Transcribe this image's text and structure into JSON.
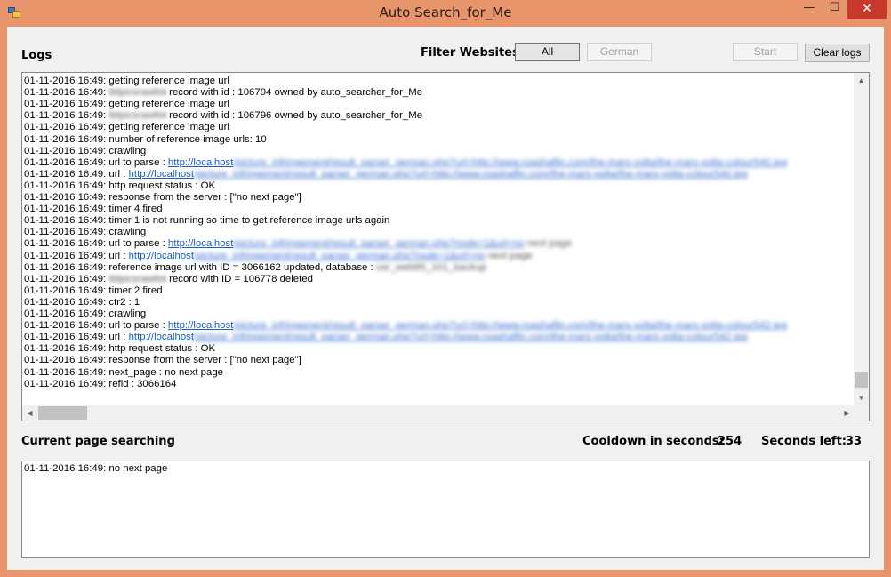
{
  "window": {
    "title": "Auto Search_for_Me",
    "minimize_glyph": "—",
    "maximize_glyph": "☐",
    "close_glyph": "✕",
    "icon": "app-window-icon"
  },
  "logs_label": "Logs",
  "filter": {
    "label": "Filter Websites",
    "all_label": "All",
    "german_label": "German"
  },
  "actions": {
    "start_label": "Start",
    "clear_label": "Clear logs"
  },
  "log_lines": [
    [
      {
        "t": "01-11-2016 16:49: getting reference image url"
      }
    ],
    [
      {
        "t": "01-11-2016 16:49: "
      },
      {
        "t": "tblpicsrawlist",
        "b": true
      },
      {
        "t": " record with id : 106794 owned by auto_searcher_for_Me"
      }
    ],
    [
      {
        "t": "01-11-2016 16:49: getting reference image url"
      }
    ],
    [
      {
        "t": "01-11-2016 16:49: "
      },
      {
        "t": "tblpicsrawlist",
        "b": true
      },
      {
        "t": " record with id : 106796 owned by auto_searcher_for_Me"
      }
    ],
    [
      {
        "t": "01-11-2016 16:49: getting reference image url"
      }
    ],
    [
      {
        "t": "01-11-2016 16:49: number of reference image urls: 10"
      }
    ],
    [
      {
        "t": "01-11-2016 16:49: crawling"
      }
    ],
    [
      {
        "t": "01-11-2016 16:49: url to parse : "
      },
      {
        "t": "http://localhost",
        "l": true
      },
      {
        "t": "/picture_infringement/result_parser_german.php?url=http://www.roashaflin.com/the-mars-volta/the-mars-volta-colour540.jpg",
        "l": true,
        "b": true
      }
    ],
    [
      {
        "t": "01-11-2016 16:49: url : "
      },
      {
        "t": "http://localhost",
        "l": true
      },
      {
        "t": "/picture_infringement/result_parser_german.php?url=http://www.roashaflin.com/the-mars-volta/the-mars-volta-colour540.jpg",
        "l": true,
        "b": true
      }
    ],
    [
      {
        "t": "01-11-2016 16:49: http request status : OK"
      }
    ],
    [
      {
        "t": "01-11-2016 16:49: response from the server : [\"no next page\"]"
      }
    ],
    [
      {
        "t": "01-11-2016 16:49: timer 4 fired"
      }
    ],
    [
      {
        "t": "01-11-2016 16:49: timer 1 is not running so time to get reference image urls again"
      }
    ],
    [
      {
        "t": "01-11-2016 16:49: crawling"
      }
    ],
    [
      {
        "t": "01-11-2016 16:49: url to parse : "
      },
      {
        "t": "http://localhost",
        "l": true
      },
      {
        "t": "/picture_infringement/result_parser_german.php?node=1&url=no",
        "l": true,
        "b": true
      },
      {
        "t": " next page",
        "b": true
      }
    ],
    [
      {
        "t": "01-11-2016 16:49: url : "
      },
      {
        "t": "http://localhost",
        "l": true
      },
      {
        "t": "/picture_infringement/result_parser_german.php?node=1&url=no",
        "l": true,
        "b": true
      },
      {
        "t": " next page",
        "b": true
      }
    ],
    [
      {
        "t": "01-11-2016 16:49: reference image url with ID = 3066162 updated, database : "
      },
      {
        "t": "usr_web85_101_backup",
        "b": true
      }
    ],
    [
      {
        "t": "01-11-2016 16:49: "
      },
      {
        "t": "tblpicsrawlist",
        "b": true
      },
      {
        "t": " record with ID = 106778 deleted"
      }
    ],
    [
      {
        "t": "01-11-2016 16:49: timer 2 fired"
      }
    ],
    [
      {
        "t": "01-11-2016 16:49: ctr2 : 1"
      }
    ],
    [
      {
        "t": "01-11-2016 16:49: crawling"
      }
    ],
    [
      {
        "t": "01-11-2016 16:49: url to parse : "
      },
      {
        "t": "http://localhost",
        "l": true
      },
      {
        "t": "/picture_infringement/result_parser_german.php?url=http://www.roashaflin.com/the-mars-volta/the-mars-volta-colour542.jpg",
        "l": true,
        "b": true
      }
    ],
    [
      {
        "t": "01-11-2016 16:49: url : "
      },
      {
        "t": "http://localhost",
        "l": true
      },
      {
        "t": "/picture_infringement/result_parser_german.php?url=http://www.roashaflin.com/the-mars-volta/the-mars-volta-colour542.jpg",
        "l": true,
        "b": true
      }
    ],
    [
      {
        "t": "01-11-2016 16:49: http request status : OK"
      }
    ],
    [
      {
        "t": "01-11-2016 16:49: response from the server : [\"no next page\"]"
      }
    ],
    [
      {
        "t": "01-11-2016 16:49: next_page : no next page"
      }
    ],
    [
      {
        "t": "01-11-2016 16:49: refid : 3066164"
      }
    ]
  ],
  "current_page": {
    "label": "Current page searching",
    "text": "01-11-2016 16:49: no next page"
  },
  "cooldown": {
    "label": "Cooldown in seconds:",
    "value": "254"
  },
  "seconds_left": {
    "label": "Seconds left:",
    "value": "33"
  },
  "scroll": {
    "up_glyph": "▲",
    "down_glyph": "▼",
    "left_glyph": "◀",
    "right_glyph": "▶"
  },
  "colors": {
    "window_frame": "#e8956b",
    "close_button": "#c7382d",
    "link": "#1a5cc8"
  }
}
